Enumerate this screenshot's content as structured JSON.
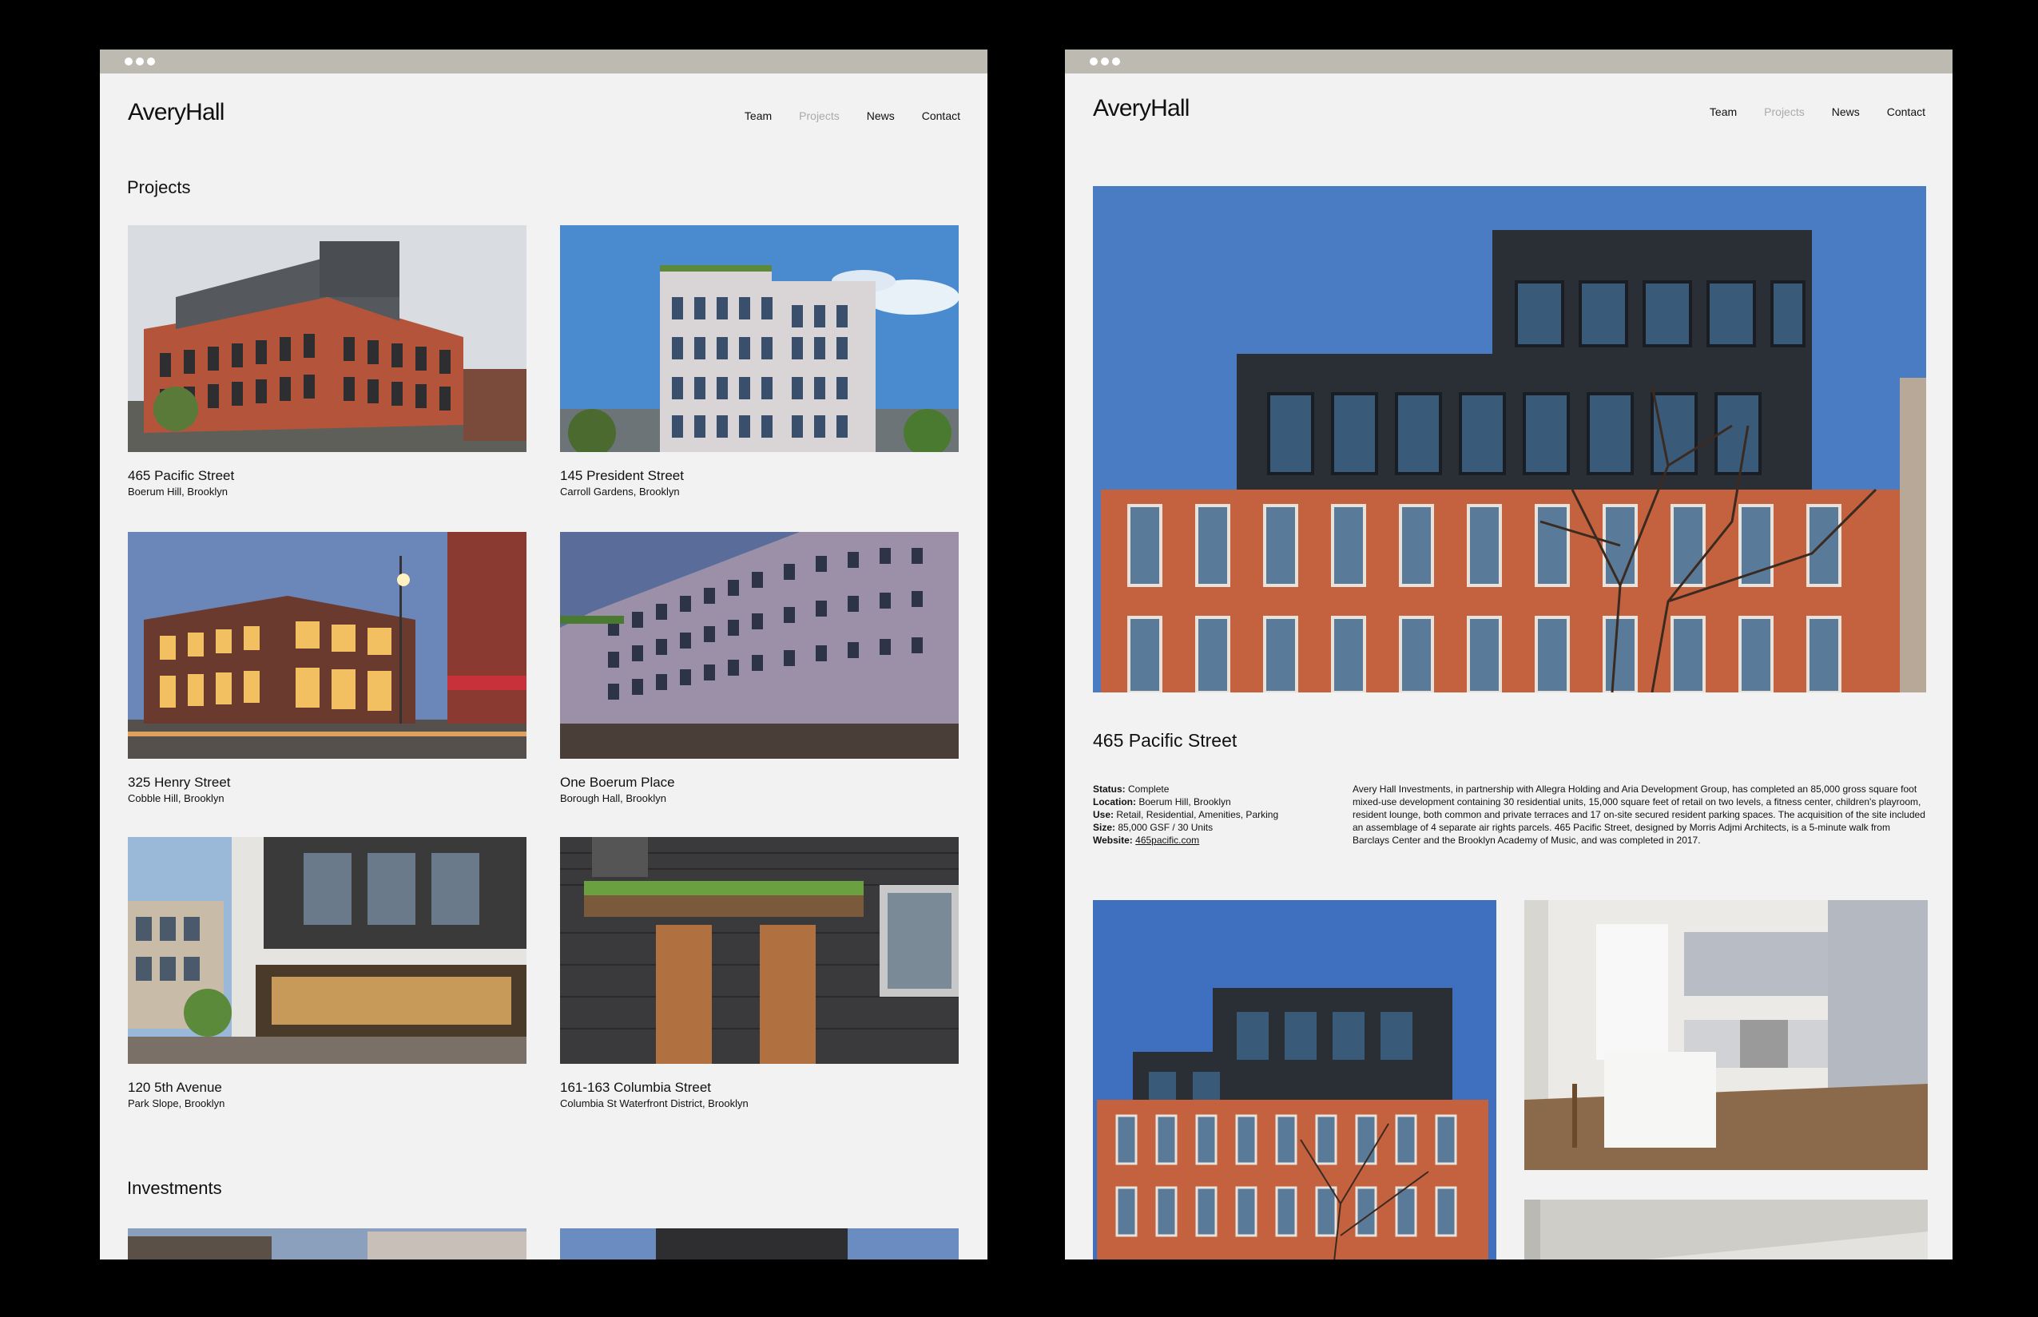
{
  "brand": {
    "logo": "AveryHall"
  },
  "nav": {
    "team": "Team",
    "projects": "Projects",
    "news": "News",
    "contact": "Contact"
  },
  "list_page": {
    "section_projects": "Projects",
    "section_investments": "Investments",
    "projects": [
      {
        "name": "465 Pacific Street",
        "location": "Boerum Hill, Brooklyn"
      },
      {
        "name": "145 President Street",
        "location": "Carroll Gardens, Brooklyn"
      },
      {
        "name": "325 Henry Street",
        "location": "Cobble Hill, Brooklyn"
      },
      {
        "name": "One Boerum Place",
        "location": "Borough Hall, Brooklyn"
      },
      {
        "name": "120 5th Avenue",
        "location": "Park Slope, Brooklyn"
      },
      {
        "name": "161-163 Columbia Street",
        "location": "Columbia St Waterfront District, Brooklyn"
      }
    ]
  },
  "detail_page": {
    "title": "465 Pacific Street",
    "meta": {
      "status_label": "Status:",
      "status": "Complete",
      "location_label": "Location:",
      "location": "Boerum Hill, Brooklyn",
      "use_label": "Use:",
      "use": "Retail, Residential, Amenities, Parking",
      "size_label": "Size:",
      "size": "85,000 GSF / 30 Units",
      "website_label": "Website:",
      "website": "465pacific.com"
    },
    "description": "Avery Hall Investments, in partnership with Allegra Holding and Aria Development Group, has completed an 85,000 gross square foot mixed-use development containing 30 residential units, 15,000 square feet of retail on two levels, a fitness center, children's playroom, resident lounge, both common and private terraces and 17 on-site secured resident parking spaces. The acquisition of the site included an assemblage of 4 separate air rights parcels. 465 Pacific Street, designed by Morris Adjmi Architects, is a 5-minute walk from Barclays Center and the Brooklyn Academy of Music, and was completed in 2017."
  },
  "colors": {
    "page_bg": "#000000",
    "window_bg": "#f2f2f2",
    "chrome": "#bdbbb1",
    "nav_active": "#aaaaaa"
  }
}
